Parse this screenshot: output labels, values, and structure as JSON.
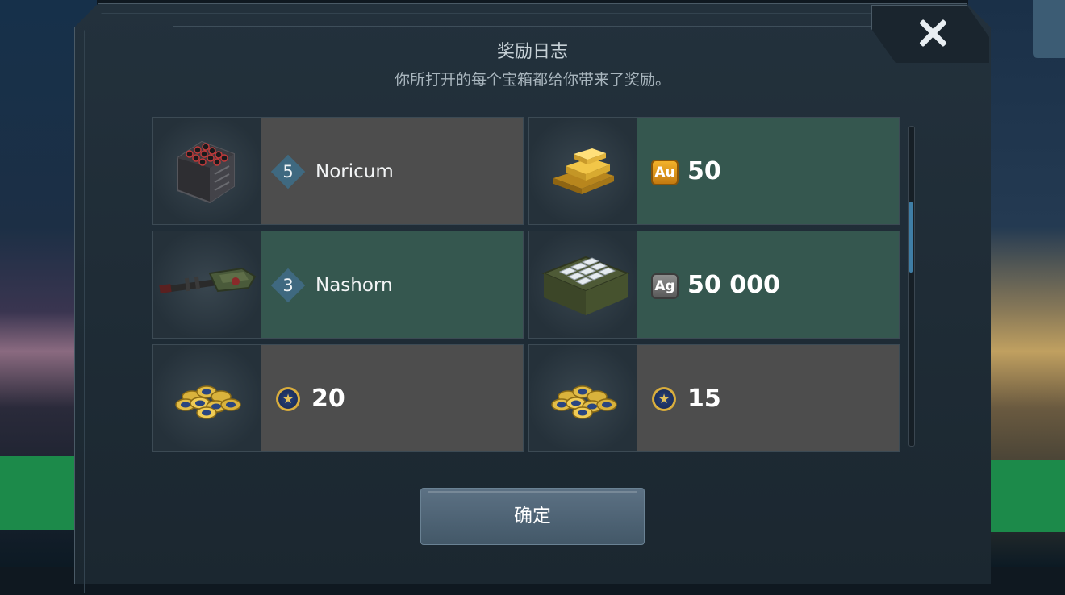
{
  "dialog": {
    "title": "奖励日志",
    "subtitle": "你所打开的每个宝箱都给你带来了奖励。",
    "confirm_label": "确定"
  },
  "rewards": [
    {
      "kind": "weapon",
      "level": "5",
      "name": "Noricum",
      "icon": "missile-pod-icon",
      "style": "gray"
    },
    {
      "kind": "currency",
      "currency": "Au",
      "amount": "50",
      "icon": "gold-bars-icon",
      "style": "green"
    },
    {
      "kind": "weapon",
      "level": "3",
      "name": "Nashorn",
      "icon": "cannon-icon",
      "style": "green"
    },
    {
      "kind": "currency",
      "currency": "Ag",
      "amount": "50 000",
      "icon": "silver-crate-icon",
      "style": "green"
    },
    {
      "kind": "tokens",
      "amount": "20",
      "icon": "star-coins-icon",
      "style": "gray"
    },
    {
      "kind": "tokens",
      "amount": "15",
      "icon": "star-coins-icon",
      "style": "gray"
    }
  ],
  "colors": {
    "gray_card": "#4d4d4d",
    "green_card": "#35574f",
    "gold": "#f3b22a",
    "silver": "#8e8e8e",
    "level_badge": "#3f6980",
    "scroll_thumb": "#3f7ea6"
  }
}
